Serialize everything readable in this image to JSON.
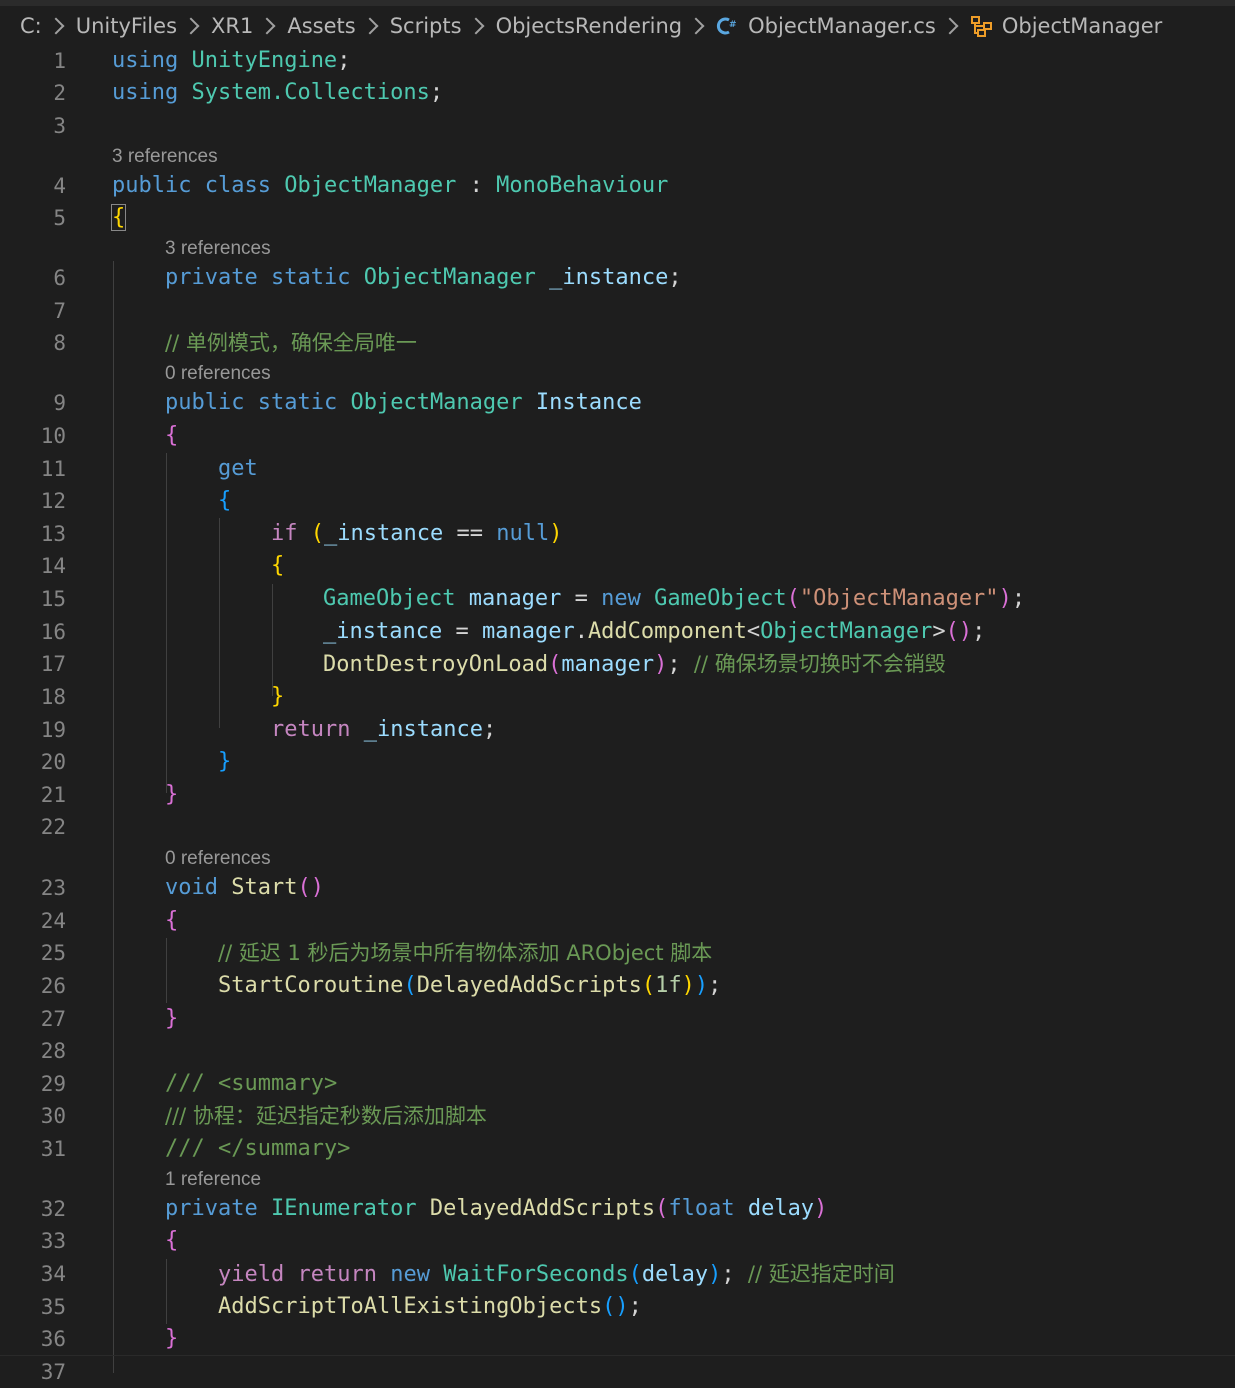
{
  "breadcrumb": {
    "items": [
      "C:",
      "UnityFiles",
      "XR1",
      "Assets",
      "Scripts",
      "ObjectsRendering"
    ],
    "file": "ObjectManager.cs",
    "symbol": "ObjectManager"
  },
  "codelens": {
    "class": "3 references",
    "instance_field": "3 references",
    "instance_prop": "0 references",
    "start": "0 references",
    "delayed": "1 reference"
  },
  "line_numbers": [
    "1",
    "2",
    "3",
    "4",
    "5",
    "6",
    "7",
    "8",
    "9",
    "10",
    "11",
    "12",
    "13",
    "14",
    "15",
    "16",
    "17",
    "18",
    "19",
    "20",
    "21",
    "22",
    "23",
    "24",
    "25",
    "26",
    "27",
    "28",
    "29",
    "30",
    "31",
    "32",
    "33",
    "34",
    "35",
    "36",
    "37"
  ],
  "code": {
    "using": "using",
    "unity_engine": "UnityEngine",
    "system_collections": "System.Collections",
    "semicolon": ";",
    "public": "public",
    "private": "private",
    "static": "static",
    "class": "class",
    "void": "void",
    "float": "float",
    "new": "new",
    "null": "null",
    "if": "if",
    "return": "return",
    "yield": "yield",
    "get": "get",
    "object_manager": "ObjectManager",
    "mono_behaviour": "MonoBehaviour",
    "colon": " : ",
    "instance_field": "_instance",
    "instance_prop": "Instance",
    "open_brace": "{",
    "close_brace": "}",
    "comment_singleton": "// 单例模式，确保全局唯一",
    "eq_null": " == ",
    "game_object": "GameObject",
    "manager": "manager",
    "assign": " = ",
    "string_object_manager": "\"ObjectManager\"",
    "add_component": "AddComponent",
    "dont_destroy": "DontDestroyOnLoad",
    "comment_scene": "// 确保场景切换时不会销毁",
    "start": "Start",
    "comment_delay": "// 延迟 1 秒后为场景中所有物体添加 ARObject 脚本",
    "start_coroutine": "StartCoroutine",
    "delayed_add": "DelayedAddScripts",
    "one_f": "1f",
    "doc_summary_open": "/// <summary>",
    "doc_summary_text": "/// 协程：延迟指定秒数后添加脚本",
    "doc_summary_close": "/// </summary>",
    "ienumerator": "IEnumerator",
    "delay": "delay",
    "wait_for_seconds": "WaitForSeconds",
    "comment_wait": "// 延迟指定时间",
    "add_script_all": "AddScriptToAllExistingObjects"
  }
}
